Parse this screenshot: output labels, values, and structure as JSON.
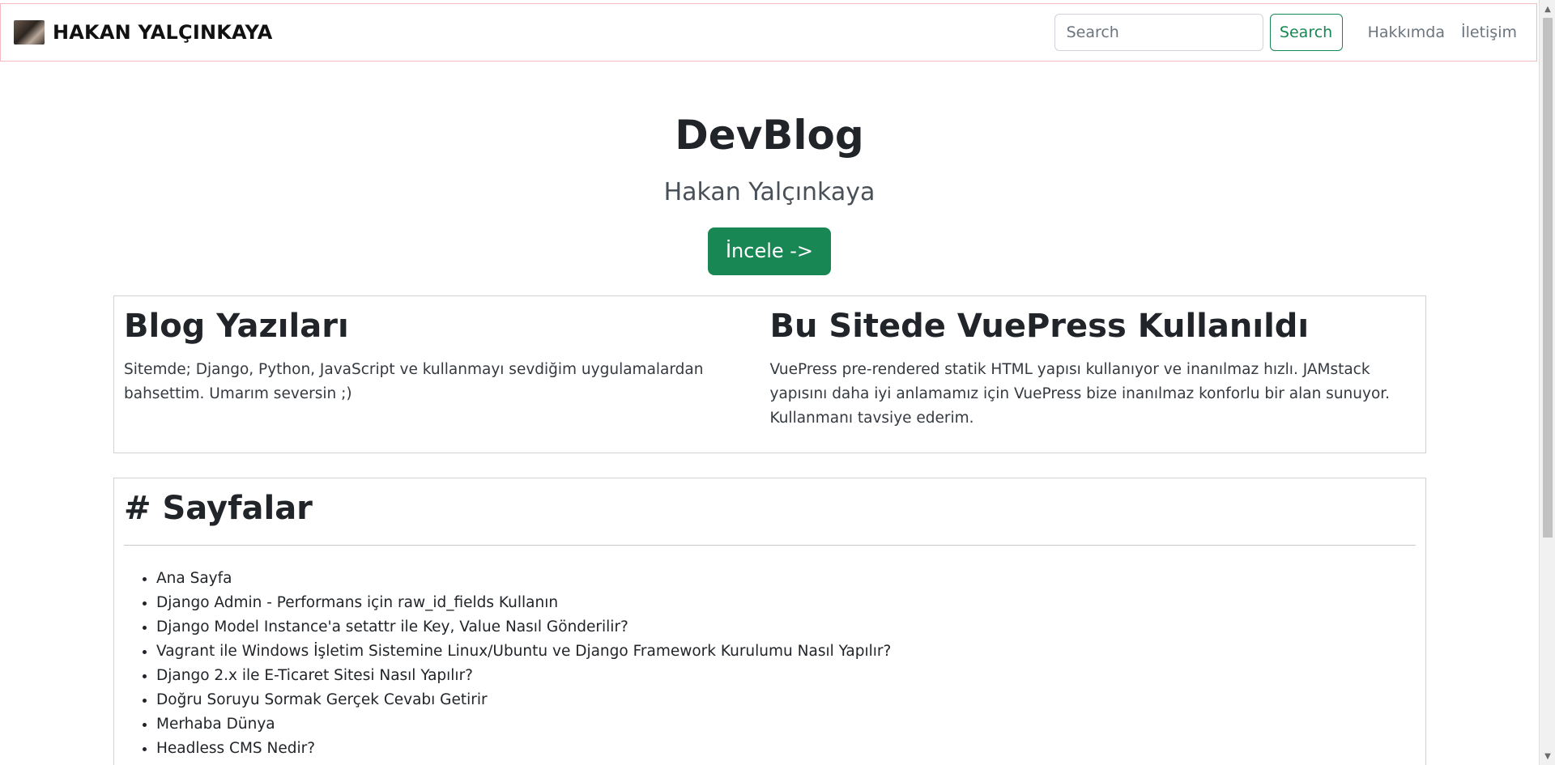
{
  "navbar": {
    "brand": "HAKAN YALÇINKAYA",
    "search_placeholder": "Search",
    "search_button": "Search",
    "links": [
      "Hakkımda",
      "İletişim"
    ]
  },
  "hero": {
    "title": "DevBlog",
    "subtitle": "Hakan Yalçınkaya",
    "button": "İncele ->"
  },
  "features": [
    {
      "title": "Blog Yazıları",
      "text": "Sitemde; Django, Python, JavaScript ve kullanmayı sevdiğim uygulamalardan bahsettim. Umarım seversin ;)"
    },
    {
      "title": "Bu Sitede VuePress Kullanıldı",
      "text": "VuePress pre-rendered statik HTML yapısı kullanıyor ve inanılmaz hızlı. JAMstack yapısını daha iyi anlamamız için VuePress bize inanılmaz konforlu bir alan sunuyor. Kullanmanı tavsiye ederim."
    }
  ],
  "pages": {
    "heading": "# Sayfalar",
    "items": [
      "Ana Sayfa",
      "Django Admin - Performans için raw_id_fields Kullanın",
      "Django Model Instance'a setattr ile Key, Value Nasıl Gönderilir?",
      "Vagrant ile Windows İşletim Sistemine Linux/Ubuntu ve Django Framework Kurulumu Nasıl Yapılır?",
      "Django 2.x ile E-Ticaret Sitesi Nasıl Yapılır?",
      "Doğru Soruyu Sormak Gerçek Cevabı Getirir",
      "Merhaba Dünya",
      "Headless CMS Nedir?"
    ]
  },
  "colors": {
    "primary_green": "#198754",
    "navbar_border": "#f2b9bf"
  }
}
